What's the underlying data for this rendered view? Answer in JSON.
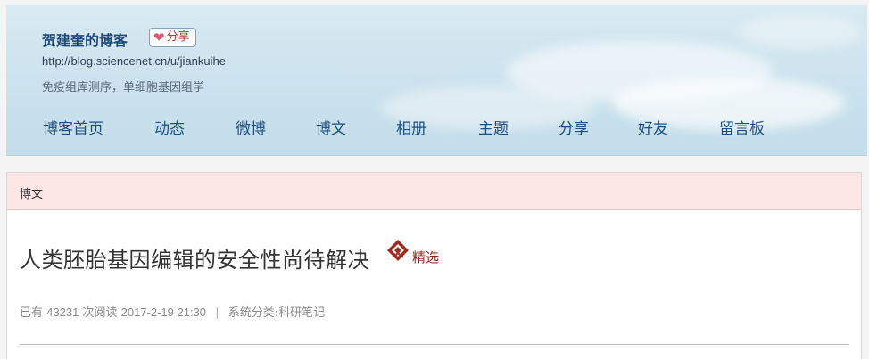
{
  "header": {
    "blog_title": "贺建奎的博客",
    "share_label": "分享",
    "blog_url": "http://blog.sciencenet.cn/u/jiankuihe",
    "blog_desc": "免疫组库测序，单细胞基因组学"
  },
  "nav": {
    "items": [
      {
        "label": "博客首页"
      },
      {
        "label": "动态",
        "active": true
      },
      {
        "label": "微博"
      },
      {
        "label": "博文"
      },
      {
        "label": "相册"
      },
      {
        "label": "主题"
      },
      {
        "label": "分享"
      },
      {
        "label": "好友"
      },
      {
        "label": "留言板"
      }
    ]
  },
  "panel": {
    "section_title": "博文",
    "article_title": "人类胚胎基因编辑的安全性尚待解决",
    "featured_label": "精选",
    "meta": {
      "read_prefix": "已有",
      "read_count": "43231",
      "read_suffix": "次阅读",
      "datetime": "2017-2-19 21:30",
      "separator": "|",
      "category": "系统分类:科研笔记"
    }
  },
  "colors": {
    "nav_text": "#1d4f80",
    "section_head_bg": "#fde6e6",
    "featured_red": "#a3281c"
  }
}
